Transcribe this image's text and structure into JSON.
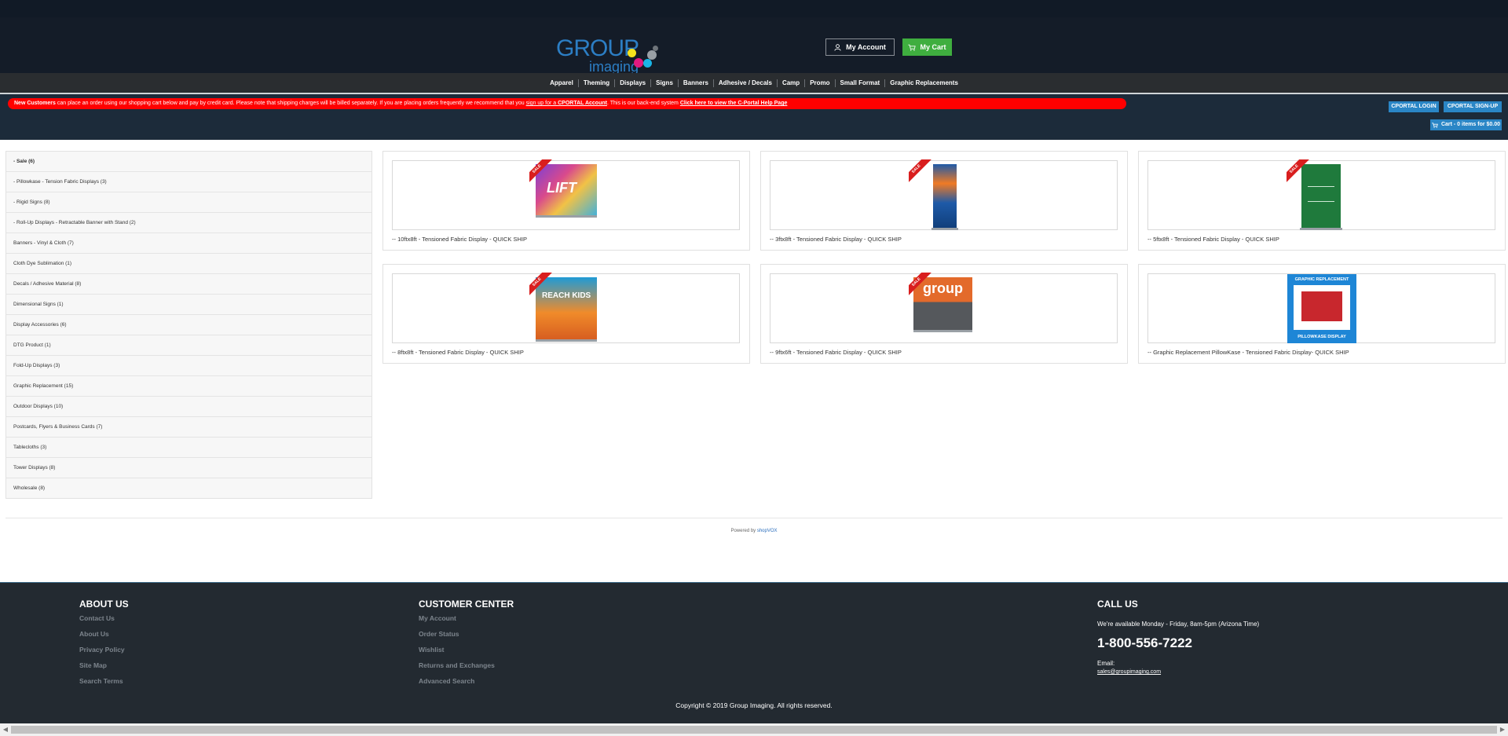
{
  "header": {
    "logo_main": "GROUP",
    "logo_sub": "imaging",
    "my_account": "My Account",
    "my_cart": "My Cart"
  },
  "nav": [
    "Apparel",
    "Theming",
    "Displays",
    "Signs",
    "Banners",
    "Adhesive / Decals",
    "Camp",
    "Promo",
    "Small Format",
    "Graphic Replacements"
  ],
  "notice": {
    "bold_lead": "New Customers",
    "text1": " can place an order using our shopping cart below and pay by credit card. Please note that shipping charges will be billed separately. If you are placing orders frequently we recommend that you ",
    "link1": "sign up for a ",
    "link1b": "CPORTAL Account",
    "text2": ". This is our back-end system ",
    "link2": "Click here to view the C-Portal Help Page"
  },
  "cportal": {
    "login": "CPORTAL LOGIN",
    "signup": "CPORTAL SIGN-UP",
    "cart": "Cart - 0 items for $0.00"
  },
  "sidebar": [
    "- Sale (6)",
    "- Pillowkase - Tension Fabric Displays (3)",
    "- Rigid Signs (8)",
    "- Roll-Up Displays - Retractable Banner with Stand (2)",
    "Banners - Vinyl & Cloth (7)",
    "Cloth Dye Sublimation (1)",
    "Decals / Adhesive Material (8)",
    "Dimensional Signs (1)",
    "Display Accessories (6)",
    "DTG Product (1)",
    "Fold-Up Displays (3)",
    "Graphic Replacement (15)",
    "Outdoor Displays (10)",
    "Postcards, Flyers & Business Cards (7)",
    "Tablecloths (3)",
    "Tower Displays (8)",
    "Wholesale (8)"
  ],
  "products": [
    {
      "title": "-- 10ftx8ft - Tensioned Fabric Display - QUICK SHIP",
      "ribbon": "SALE",
      "art": "LIFT"
    },
    {
      "title": "-- 3ftx8ft - Tensioned Fabric Display - QUICK SHIP",
      "ribbon": "SALE",
      "art": ""
    },
    {
      "title": "-- 5ftx8ft - Tensioned Fabric Display - QUICK SHIP",
      "ribbon": "SALE",
      "art": ""
    },
    {
      "title": "-- 8ftx8ft - Tensioned Fabric Display - QUICK SHIP",
      "ribbon": "SALE",
      "art": "REACH KIDS"
    },
    {
      "title": "-- 9ftx6ft - Tensioned Fabric Display - QUICK SHIP",
      "ribbon": "SALE",
      "art": "group"
    },
    {
      "title": "-- Graphic Replacement PillowKase - Tensioned Fabric Display- QUICK SHIP",
      "ribbon": "",
      "art_top": "GRAPHIC REPLACEMENT",
      "art_bottom": "PILLOWKASE DISPLAY"
    }
  ],
  "powered": {
    "prefix": "Powered by ",
    "link": "shopVOX"
  },
  "footer": {
    "about_title": "ABOUT US",
    "about_links": [
      "Contact Us",
      "About Us",
      "Privacy Policy",
      "Site Map",
      "Search Terms"
    ],
    "customer_title": "CUSTOMER CENTER",
    "customer_links": [
      "My Account",
      "Order Status",
      "Wishlist",
      "Returns and Exchanges",
      "Advanced Search"
    ],
    "call_title": "CALL US",
    "hours": "We're available Monday - Friday, 8am-5pm (Arizona Time)",
    "phone": "1-800-556-7222",
    "email_label": "Email:",
    "email": "sales@groupimaging.com",
    "copyright": "Copyright © 2019 Group Imaging. All rights reserved."
  },
  "colors": {
    "header_bg": "#141c28",
    "nav_bg": "#2a2d30",
    "notice_red": "#ff0000",
    "cportal_blue": "#2a86c6",
    "cart_green": "#3fae3f",
    "footer_bg": "#232a31",
    "ribbon_red": "#d91e1e"
  }
}
